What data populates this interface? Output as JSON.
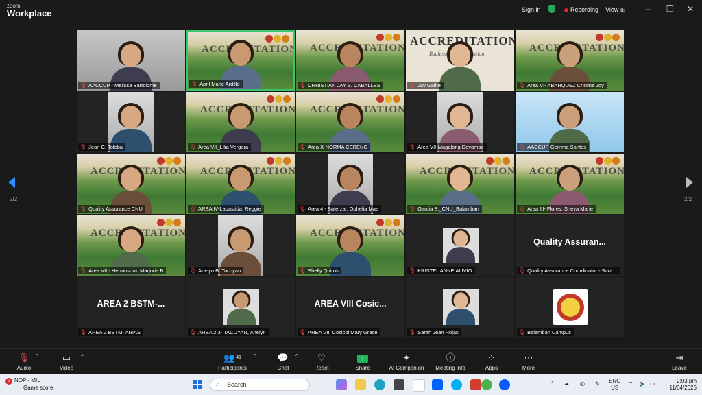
{
  "app": {
    "logo_line1": "zoom",
    "logo_line2": "Workplace",
    "sign_in": "Sign in",
    "recording": "Recording",
    "view": "View",
    "accent": "#3ac46b",
    "recording_color": "#e0242b"
  },
  "tile_text": {
    "accreditation": "ACCREDITATION",
    "accreditation_sub": "Bachelor of ... Education"
  },
  "participants": [
    {
      "name": "AACCUP - Melissa Bartolome",
      "bg": "room"
    },
    {
      "name": "April Marie Ardillo",
      "bg": "acc",
      "active": true
    },
    {
      "name": "CHRISTIAN JAY S. CABALLES",
      "bg": "acc"
    },
    {
      "name": "Jay Gaihe",
      "bg": "plain"
    },
    {
      "name": "Area VI- ABARQUEZ Cristine Joy",
      "bg": "acc"
    },
    {
      "name": "Jean C. Toleba",
      "bg": "narrow"
    },
    {
      "name": "Area VII_Lilia Vergara",
      "bg": "acc"
    },
    {
      "name": "Area X-NORMA CERENO",
      "bg": "acc"
    },
    {
      "name": "Area VII-Magalong Dovamae",
      "bg": "narrow"
    },
    {
      "name": "AACCUP-Gemma Santos",
      "bg": "blue"
    },
    {
      "name": "Quality Assurance CNU",
      "bg": "acc"
    },
    {
      "name": "AREA IV-Labastida, Reggie",
      "bg": "acc"
    },
    {
      "name": "Area 4 - Baterzal, Ophelia Mae",
      "bg": "narrow"
    },
    {
      "name": "Garcia B._CNU_Balamban",
      "bg": "acc"
    },
    {
      "name": "Area III- Flores, Sheva Marie",
      "bg": "acc"
    },
    {
      "name": "Area VII - Hermosora, Marjorie B",
      "bg": "acc"
    },
    {
      "name": "Anelyn B. Tacuyan",
      "bg": "narrow"
    },
    {
      "name": "Shelly Quiros",
      "bg": "acc"
    },
    {
      "name": "KRISTEL ANNE ALIVIO",
      "bg": "avatar"
    },
    {
      "name": "Quality Assurance Coordinator - Sara...",
      "bg": "text",
      "big": "Quality  Assuran..."
    },
    {
      "name": "AREA 2 BSTM- ARIAS",
      "bg": "text",
      "big": "AREA 2 BSTM-..."
    },
    {
      "name": "AREA 2,3- TACUYAN, Anelyn",
      "bg": "avatar"
    },
    {
      "name": "AREA VIII Cosicol Mary Grace",
      "bg": "text",
      "big": "AREA VIII Cosic..."
    },
    {
      "name": "Sarah Jean Rojas",
      "bg": "avatar"
    },
    {
      "name": "Balamban Campus",
      "bg": "seal"
    }
  ],
  "pagination": {
    "left": "2/2",
    "right": "2/2"
  },
  "toolbar": {
    "audio": "Audio",
    "video": "Video",
    "participants": "Participants",
    "participants_count": "41",
    "chat": "Chat",
    "react": "React",
    "share": "Share",
    "ai": "AI Companion",
    "meeting_info": "Meeting info",
    "apps": "Apps",
    "more": "More",
    "leave": "Leave"
  },
  "taskbar": {
    "notif_count": "2",
    "app_title": "NOP - MIL",
    "app_sub": "Game score",
    "search": "Search",
    "lang1": "ENG",
    "lang2": "US",
    "time": "2:03 pm",
    "date": "11/04/2025"
  }
}
